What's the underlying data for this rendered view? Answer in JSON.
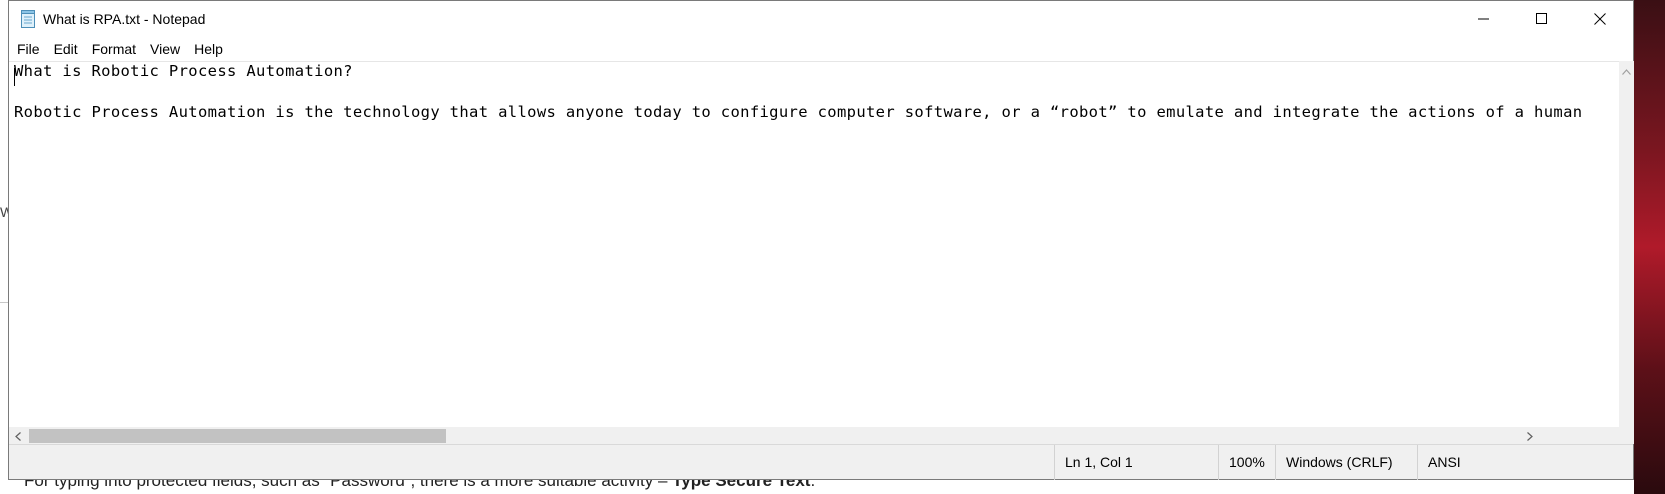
{
  "window": {
    "title": "What is RPA.txt - Notepad"
  },
  "menu": {
    "items": [
      "File",
      "Edit",
      "Format",
      "View",
      "Help"
    ]
  },
  "editor": {
    "lines": [
      "What is Robotic Process Automation?",
      "",
      "Robotic Process Automation is the technology that allows anyone today to configure computer software, or a “robot” to emulate and integrate the actions of a human"
    ]
  },
  "statusbar": {
    "position": "Ln 1, Col 1",
    "zoom": "100%",
    "line_ending": "Windows (CRLF)",
    "encoding": "ANSI"
  },
  "background": {
    "bottom_text_prefix": "For typing into protected fields, such as “Password”, there is a more suitable activity – ",
    "bottom_text_bold": "Type Secure Text",
    "bottom_text_suffix": ".",
    "left_letter": "W"
  },
  "icons": {
    "app": "notepad-icon",
    "minimize": "minimize-icon",
    "maximize": "maximize-icon",
    "close": "close-icon",
    "scroll_up": "chevron-up-icon",
    "scroll_left": "chevron-left-icon",
    "scroll_right": "chevron-right-icon"
  }
}
